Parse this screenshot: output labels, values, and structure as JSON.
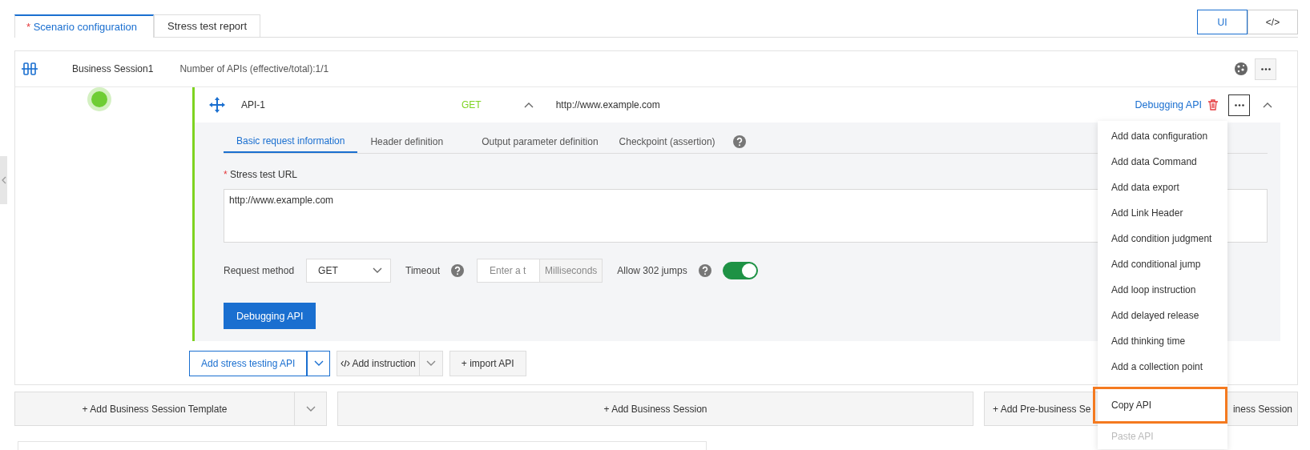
{
  "tabs": [
    {
      "mark": "*",
      "label": "Scenario configuration",
      "selected": true
    },
    {
      "label": "Stress test report",
      "selected": false
    }
  ],
  "view_toggle": [
    {
      "label": "UI",
      "selected": true
    },
    {
      "label": "</>",
      "selected": false
    }
  ],
  "session": {
    "name": "Business Session1",
    "api_count": "Number of APIs (effective/total):1/1",
    "api": {
      "name": "API-1",
      "method": "GET",
      "url": "http://www.example.com",
      "debug_link": "Debugging API",
      "expanded": true,
      "tabs": [
        {
          "label": "Basic request information",
          "selected": true
        },
        {
          "label": "Header definition",
          "selected": false
        },
        {
          "label": "Output parameter definition",
          "selected": false
        },
        {
          "label": "Checkpoint (assertion)",
          "selected": false,
          "help": true
        }
      ],
      "url_mark": "*",
      "url_label": "Stress test URL",
      "url_value": "http://www.example.com",
      "method_label": "Request method",
      "method_value": "GET",
      "timeout_label": "Timeout",
      "timeout_placeholder": "Enter a t",
      "timeout_unit": "Milliseconds",
      "redirect_label": "Allow 302 jumps",
      "redirect_on": true,
      "debug_button": "Debugging API"
    },
    "actions": [
      {
        "label": "Add stress testing API",
        "kind": "split",
        "primary": true
      },
      {
        "label": "Add instruction",
        "kind": "split",
        "primary": false,
        "code_icon": true
      },
      {
        "label": "+ import API",
        "kind": "plain",
        "primary": false
      }
    ]
  },
  "add_buttons": [
    {
      "label": "+ Add Business Session Template",
      "kind": "split"
    },
    {
      "label": "+ Add Business Session",
      "kind": "plain"
    },
    {
      "label": "+ Add Pre-business Se",
      "tail": "iness Session",
      "kind": "covered"
    }
  ],
  "menu": {
    "items": [
      {
        "label": "Add data configuration",
        "disabled": false,
        "highlighted": false
      },
      {
        "label": "Add data Command",
        "disabled": false,
        "highlighted": false
      },
      {
        "label": "Add data export",
        "disabled": false,
        "highlighted": false
      },
      {
        "label": "Add Link Header",
        "disabled": false,
        "highlighted": false
      },
      {
        "label": "Add condition judgment",
        "disabled": false,
        "highlighted": false
      },
      {
        "label": "Add conditional jump",
        "disabled": false,
        "highlighted": false
      },
      {
        "label": "Add loop instruction",
        "disabled": false,
        "highlighted": false
      },
      {
        "label": "Add delayed release",
        "disabled": false,
        "highlighted": false
      },
      {
        "label": "Add thinking time",
        "disabled": false,
        "highlighted": false
      },
      {
        "label": "Add a collection point",
        "disabled": false,
        "highlighted": false,
        "divider_after": true
      },
      {
        "label": "Copy API",
        "disabled": false,
        "highlighted": true
      },
      {
        "label": "Paste API",
        "disabled": true,
        "highlighted": false
      }
    ]
  }
}
